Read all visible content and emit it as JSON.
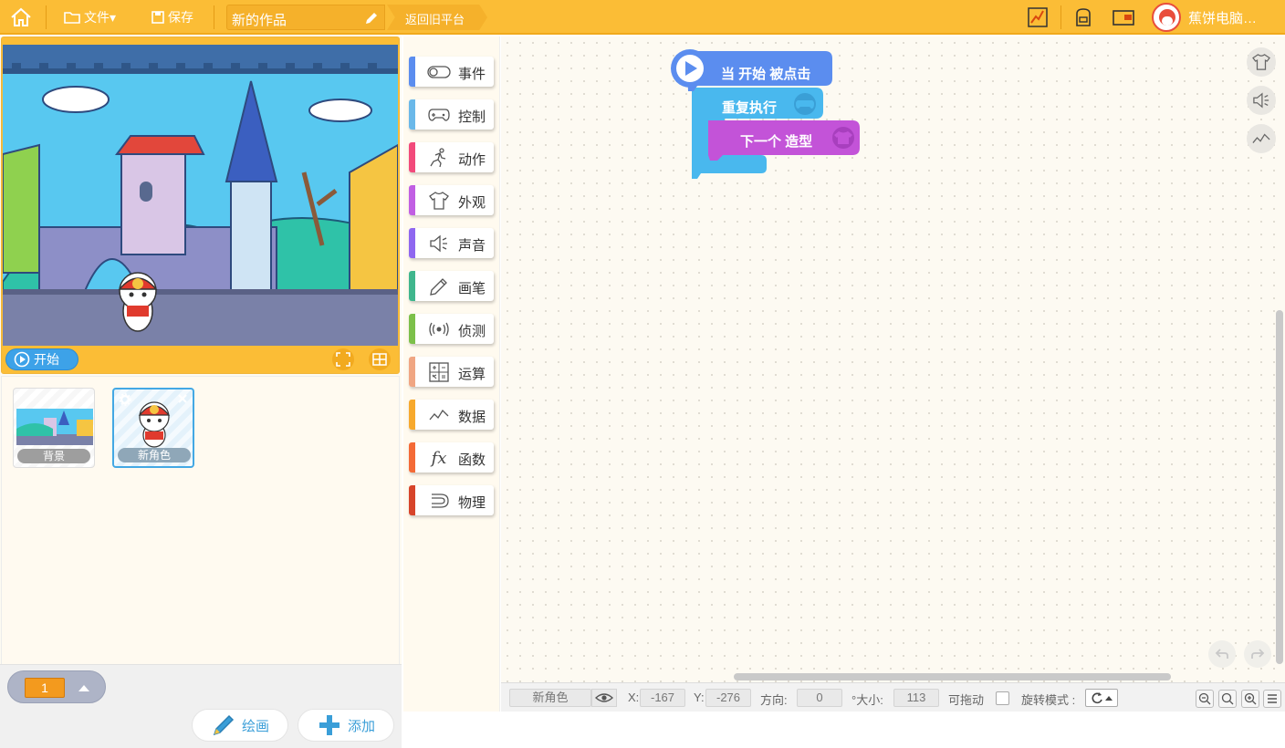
{
  "topbar": {
    "file_label": "文件▾",
    "save_label": "保存",
    "project_title": "新的作品",
    "back_old_label": "返回旧平台",
    "username": "蕉饼电脑…"
  },
  "stage": {
    "start_label": "开始"
  },
  "sprites": {
    "items": [
      {
        "label": "背景"
      },
      {
        "label": "新角色"
      }
    ]
  },
  "bottom": {
    "page_number": "1",
    "draw_label": "绘画",
    "add_label": "添加"
  },
  "palette": {
    "categories": [
      {
        "label": "事件",
        "color": "#5b8def",
        "icon": "toggle-icon"
      },
      {
        "label": "控制",
        "color": "#6ab8e9",
        "icon": "gamepad-icon"
      },
      {
        "label": "动作",
        "color": "#f24a7b",
        "icon": "run-icon"
      },
      {
        "label": "外观",
        "color": "#c15fe3",
        "icon": "shirt-icon"
      },
      {
        "label": "声音",
        "color": "#8f67f0",
        "icon": "speaker-icon"
      },
      {
        "label": "画笔",
        "color": "#3fb68d",
        "icon": "pencil-icon"
      },
      {
        "label": "侦测",
        "color": "#7cc04a",
        "icon": "radar-icon"
      },
      {
        "label": "运算",
        "color": "#f0a683",
        "icon": "calculator-icon"
      },
      {
        "label": "数据",
        "color": "#f7a92d",
        "icon": "chart-icon"
      },
      {
        "label": "函数",
        "color": "#f46a36",
        "icon": "function-icon"
      },
      {
        "label": "物理",
        "color": "#d7442a",
        "icon": "magnet-icon"
      }
    ]
  },
  "script": {
    "hat_label": "当 开始 被点击",
    "repeat_label": "重复执行",
    "next_costume_label": "下一个 造型"
  },
  "status": {
    "sprite_name": "新角色",
    "x_label": "X:",
    "x_value": "-167",
    "y_label": "Y:",
    "y_value": "-276",
    "direction_label": "方向:",
    "direction_value": "0",
    "size_label": "°大小:",
    "size_value": "113",
    "draggable_label": "可拖动",
    "rotation_label": "旋转模式 :"
  }
}
